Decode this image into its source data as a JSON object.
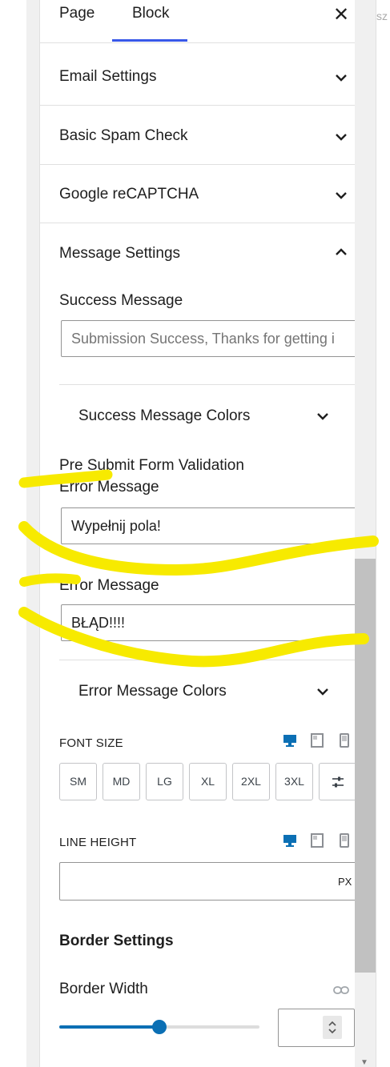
{
  "tabs": {
    "page": "Page",
    "block": "Block",
    "close": "✕"
  },
  "right_fragment": "sz",
  "sections": {
    "email": "Email Settings",
    "spam": "Basic Spam Check",
    "recaptcha": "Google reCAPTCHA",
    "message": "Message Settings"
  },
  "message_settings": {
    "success_label": "Success Message",
    "success_placeholder": "Submission Success, Thanks for getting i",
    "success_colors": "Success Message Colors",
    "pre_submit_label_line1": "Pre Submit Form Validation",
    "pre_submit_label_line2": "Error Message",
    "pre_submit_value": "Wypełnij pola!",
    "error_label": "Error Message",
    "error_value": "BŁĄD!!!!",
    "error_colors": "Error Message Colors"
  },
  "font_size": {
    "label": "FONT SIZE",
    "sizes": [
      "SM",
      "MD",
      "LG",
      "XL",
      "2XL",
      "3XL"
    ]
  },
  "line_height": {
    "label": "LINE HEIGHT",
    "unit": "PX",
    "value": ""
  },
  "border": {
    "title": "Border Settings",
    "width_label": "Border Width",
    "width_value": "",
    "slider_fraction": 0.5
  },
  "colors": {
    "accent": "#0b6fb4",
    "tab_underline": "#3858e9",
    "highlight": "#f7ea00"
  },
  "icons": [
    "close-icon",
    "chevron-down-icon",
    "chevron-up-icon",
    "desktop-icon",
    "tablet-icon",
    "mobile-icon",
    "sliders-icon",
    "link-icon",
    "spinner-icon"
  ]
}
